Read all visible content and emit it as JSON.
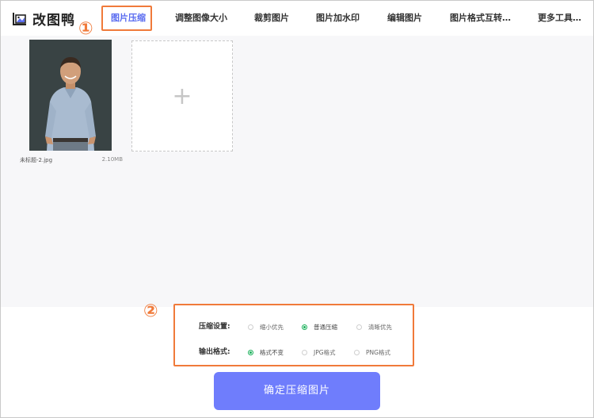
{
  "app": {
    "name": "改图鸭"
  },
  "nav": {
    "items": [
      {
        "label": "图片压缩",
        "active": true
      },
      {
        "label": "调整图像大小"
      },
      {
        "label": "裁剪图片"
      },
      {
        "label": "图片加水印"
      },
      {
        "label": "编辑图片"
      },
      {
        "label": "图片格式互转…"
      },
      {
        "label": "更多工具…"
      }
    ]
  },
  "annotations": {
    "step1": "①",
    "step2": "②"
  },
  "file": {
    "name": "未标题-2.jpg",
    "size": "2.10MB"
  },
  "add_tile": {
    "icon": "plus-icon",
    "label": "+"
  },
  "settings": {
    "compression": {
      "label": "压缩设置:",
      "options": [
        "缩小优先",
        "普通压缩",
        "清晰优先"
      ],
      "selected": "普通压缩"
    },
    "output": {
      "label": "输出格式:",
      "options": [
        "格式不变",
        "JPG格式",
        "PNG格式"
      ],
      "selected": "格式不变"
    }
  },
  "confirm_button": {
    "label": "确定压缩图片"
  },
  "colors": {
    "accent": "#6f7dfc",
    "active_nav": "#5a6cf0",
    "annotation": "#f07a3a",
    "radio_on": "#1ab05a"
  }
}
